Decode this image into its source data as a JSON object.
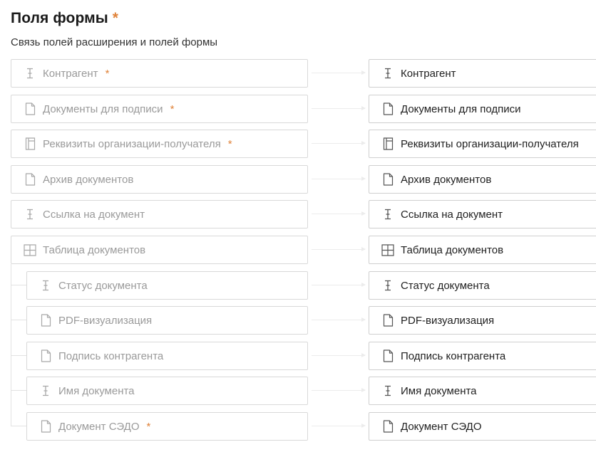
{
  "header": {
    "title": "Поля формы",
    "title_required_mark": "*",
    "subtitle": "Связь полей расширения и полей формы"
  },
  "colors": {
    "required": "#e0833a",
    "border": "#d9d9d9",
    "muted_text": "#9a9a9a"
  },
  "mappings": [
    {
      "left_label": "Контрагент",
      "left_required": "*",
      "right_label": "Контрагент",
      "icon": "text-cursor-icon",
      "child": false
    },
    {
      "left_label": "Документы для подписи",
      "left_required": "*",
      "right_label": "Документы для подписи",
      "icon": "file-icon",
      "child": false
    },
    {
      "left_label": "Реквизиты организации-получателя",
      "left_required": "*",
      "right_label": "Реквизиты организации-получателя",
      "icon": "form-icon",
      "child": false
    },
    {
      "left_label": "Архив документов",
      "left_required": "",
      "right_label": "Архив документов",
      "icon": "file-icon",
      "child": false
    },
    {
      "left_label": "Ссылка на документ",
      "left_required": "",
      "right_label": "Ссылка на документ",
      "icon": "text-cursor-icon",
      "child": false
    },
    {
      "left_label": "Таблица документов",
      "left_required": "",
      "right_label": "Таблица документов",
      "icon": "table-icon",
      "child": false
    },
    {
      "left_label": "Статус документа",
      "left_required": "",
      "right_label": "Статус документа",
      "icon": "text-cursor-icon",
      "child": true
    },
    {
      "left_label": "PDF-визуализация",
      "left_required": "",
      "right_label": "PDF-визуализация",
      "icon": "file-icon",
      "child": true
    },
    {
      "left_label": "Подпись контрагента",
      "left_required": "",
      "right_label": "Подпись контрагента",
      "icon": "file-icon",
      "child": true
    },
    {
      "left_label": "Имя документа",
      "left_required": "",
      "right_label": "Имя документа",
      "icon": "text-cursor-icon",
      "child": true
    },
    {
      "left_label": "Документ СЭДО",
      "left_required": "*",
      "right_label": "Документ СЭДО",
      "icon": "file-icon",
      "child": true
    }
  ]
}
